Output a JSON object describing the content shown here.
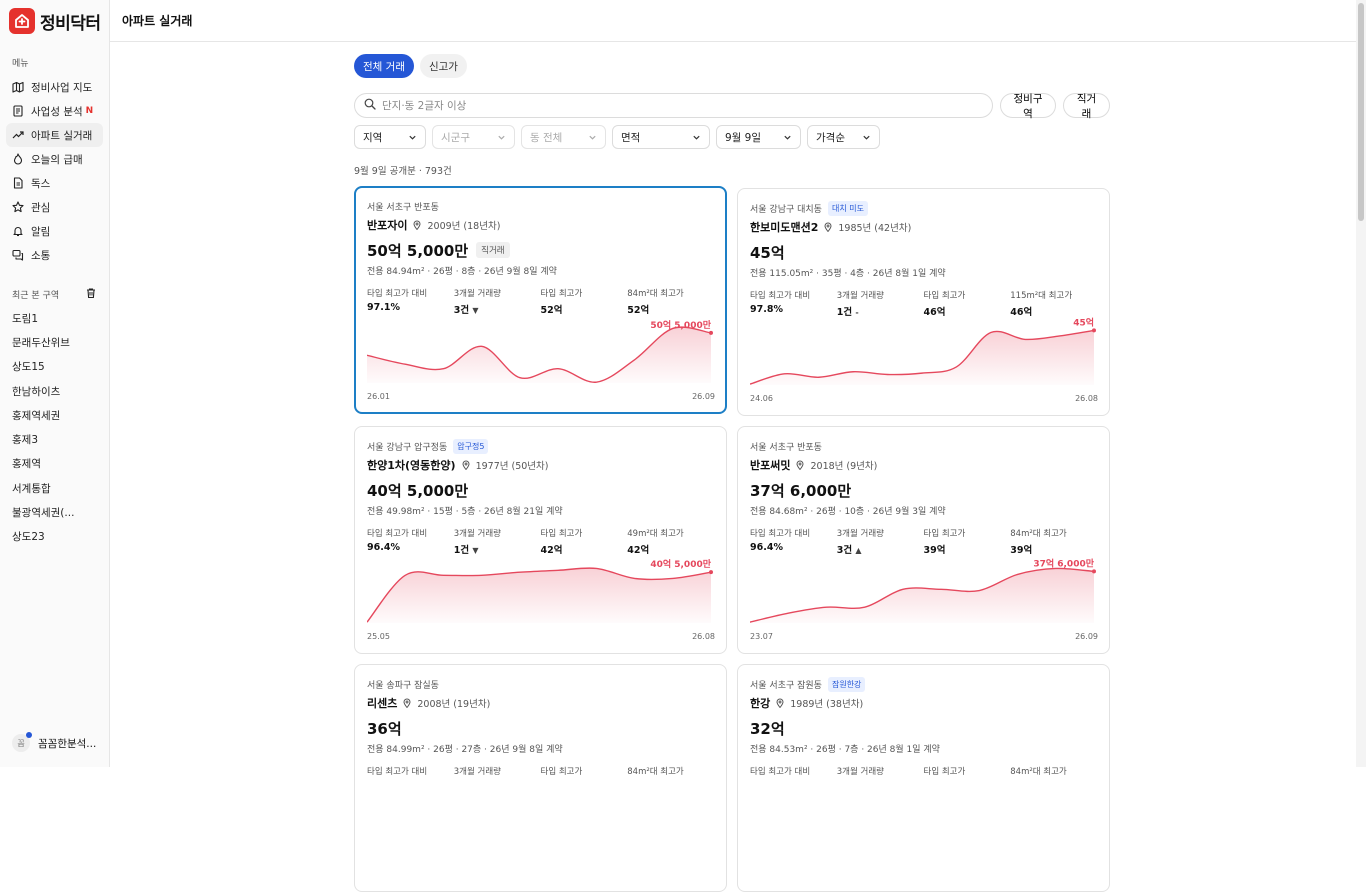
{
  "app": {
    "logo_text": "정비닥터",
    "page_title": "아파트 실거래"
  },
  "sidebar": {
    "menu_label": "메뉴",
    "nav": [
      {
        "label": "정비사업 지도",
        "icon": "map-icon"
      },
      {
        "label": "사업성 분석",
        "icon": "document-icon",
        "badge": "N"
      },
      {
        "label": "아파트 실거래",
        "icon": "trend-icon",
        "active": true
      },
      {
        "label": "오늘의 급매",
        "icon": "fire-icon"
      },
      {
        "label": "독스",
        "icon": "file-icon"
      },
      {
        "label": "관심",
        "icon": "star-icon"
      },
      {
        "label": "알림",
        "icon": "bell-icon"
      },
      {
        "label": "소통",
        "icon": "chat-icon"
      }
    ],
    "recent_label": "최근 본 구역",
    "recent": [
      "도림1",
      "문래두산위브",
      "상도15",
      "한남하이츠",
      "홍제역세권",
      "홍제3",
      "홍제역",
      "서계통합",
      "불광역세권(...",
      "상도23"
    ],
    "profile_initial": "꼼",
    "profile_name": "꼼꼼한분석..."
  },
  "tabs": [
    {
      "label": "전체 거래",
      "active": true
    },
    {
      "label": "신고가",
      "active": false
    }
  ],
  "search": {
    "placeholder": "단지·동 2글자 이상",
    "btn_zone": "정비구역",
    "btn_direct": "직거래"
  },
  "filters": [
    {
      "label": "지역",
      "width": 72,
      "disabled": false
    },
    {
      "label": "시군구",
      "width": 83,
      "disabled": true
    },
    {
      "label": "동 전체",
      "width": 85,
      "disabled": true
    },
    {
      "label": "면적",
      "width": 98,
      "disabled": false
    },
    {
      "label": "9월 9일",
      "width": 85,
      "disabled": false
    },
    {
      "label": "가격순",
      "width": 73,
      "disabled": false
    }
  ],
  "result_count": "9월 9일 공개분 · 793건",
  "colors": {
    "accent": "#2557d6",
    "chart_line": "#e5485d",
    "selected_border": "#1d7fc6"
  },
  "cards": [
    {
      "location": "서울 서초구 반포동",
      "tag": "",
      "name": "반포자이",
      "year": "2009년 (18년차)",
      "price": "50억 5,000만",
      "price_tag": "직거래",
      "detail": "전용 84.94m² · 26평 · 8층 · 26년 9월 8일 계약",
      "stats": [
        {
          "label": "타입 최고가 대비",
          "value": "97.1%"
        },
        {
          "label": "3개월 거래량",
          "value": "3건",
          "trend": "▼"
        },
        {
          "label": "타입 최고가",
          "value": "52억"
        },
        {
          "label": "84m²대 최고가",
          "value": "52억"
        }
      ],
      "chart": {
        "start": "26.01",
        "end": "26.09",
        "last_label": "50억 5,000만",
        "series": [
          44.5,
          43.5,
          43.0,
          45.5,
          42.0,
          43.0,
          41.5,
          44.0,
          47.5,
          47.0
        ]
      },
      "selected": true
    },
    {
      "location": "서울 강남구 대치동",
      "tag": "대치 미도",
      "name": "한보미도맨션2",
      "year": "1985년 (42년차)",
      "price": "45억",
      "price_tag": "",
      "detail": "전용 115.05m² · 35평 · 4층 · 26년 8월 1일 계약",
      "stats": [
        {
          "label": "타입 최고가 대비",
          "value": "97.8%"
        },
        {
          "label": "3개월 거래량",
          "value": "1건",
          "trend": "-"
        },
        {
          "label": "타입 최고가",
          "value": "46억"
        },
        {
          "label": "115m²대 최고가",
          "value": "46억"
        }
      ],
      "chart": {
        "start": "24.06",
        "end": "26.08",
        "last_label": "45억",
        "series": [
          36.0,
          37.5,
          37.0,
          37.8,
          37.4,
          37.6,
          38.5,
          43.5,
          42.5,
          43.0,
          43.8
        ]
      },
      "selected": false
    },
    {
      "location": "서울 강남구 압구정동",
      "tag": "압구정5",
      "name": "한양1차(영동한양)",
      "year": "1977년 (50년차)",
      "price": "40억 5,000만",
      "price_tag": "",
      "detail": "전용 49.98m² · 15평 · 5층 · 26년 8월 21일 계약",
      "stats": [
        {
          "label": "타입 최고가 대비",
          "value": "96.4%"
        },
        {
          "label": "3개월 거래량",
          "value": "1건",
          "trend": "▼"
        },
        {
          "label": "타입 최고가",
          "value": "42억"
        },
        {
          "label": "49m²대 최고가",
          "value": "42억"
        }
      ],
      "chart": {
        "start": "25.05",
        "end": "26.08",
        "last_label": "40억 5,000만",
        "series": [
          31.0,
          38.5,
          38.5,
          38.5,
          39.0,
          39.3,
          39.6,
          38.0,
          38.0,
          39.0
        ]
      },
      "selected": false
    },
    {
      "location": "서울 서초구 반포동",
      "tag": "",
      "name": "반포써밋",
      "year": "2018년 (9년차)",
      "price": "37억 6,000만",
      "price_tag": "",
      "detail": "전용 84.68m² · 26평 · 10층 · 26년 9월 3일 계약",
      "stats": [
        {
          "label": "타입 최고가 대비",
          "value": "96.4%"
        },
        {
          "label": "3개월 거래량",
          "value": "3건",
          "trend": "▲"
        },
        {
          "label": "타입 최고가",
          "value": "39억"
        },
        {
          "label": "84m²대 최고가",
          "value": "39억"
        }
      ],
      "chart": {
        "start": "23.07",
        "end": "26.09",
        "last_label": "37억 6,000만",
        "series": [
          27.0,
          28.5,
          29.5,
          29.5,
          32.5,
          32.5,
          32.3,
          35.0,
          36.0,
          35.5
        ]
      },
      "selected": false
    },
    {
      "location": "서울 송파구 잠실동",
      "tag": "",
      "name": "리센츠",
      "year": "2008년 (19년차)",
      "price": "36억",
      "price_tag": "",
      "detail": "전용 84.99m² · 26평 · 27층 · 26년 9월 8일 계약",
      "stats": [
        {
          "label": "타입 최고가 대비",
          "value": ""
        },
        {
          "label": "3개월 거래량",
          "value": ""
        },
        {
          "label": "타입 최고가",
          "value": ""
        },
        {
          "label": "84m²대 최고가",
          "value": ""
        }
      ],
      "chart": null,
      "selected": false
    },
    {
      "location": "서울 서초구 잠원동",
      "tag": "잠원한강",
      "name": "한강",
      "year": "1989년 (38년차)",
      "price": "32억",
      "price_tag": "",
      "detail": "전용 84.53m² · 26평 · 7층 · 26년 8월 1일 계약",
      "stats": [
        {
          "label": "타입 최고가 대비",
          "value": ""
        },
        {
          "label": "3개월 거래량",
          "value": ""
        },
        {
          "label": "타입 최고가",
          "value": ""
        },
        {
          "label": "84m²대 최고가",
          "value": ""
        }
      ],
      "chart": null,
      "selected": false
    }
  ]
}
